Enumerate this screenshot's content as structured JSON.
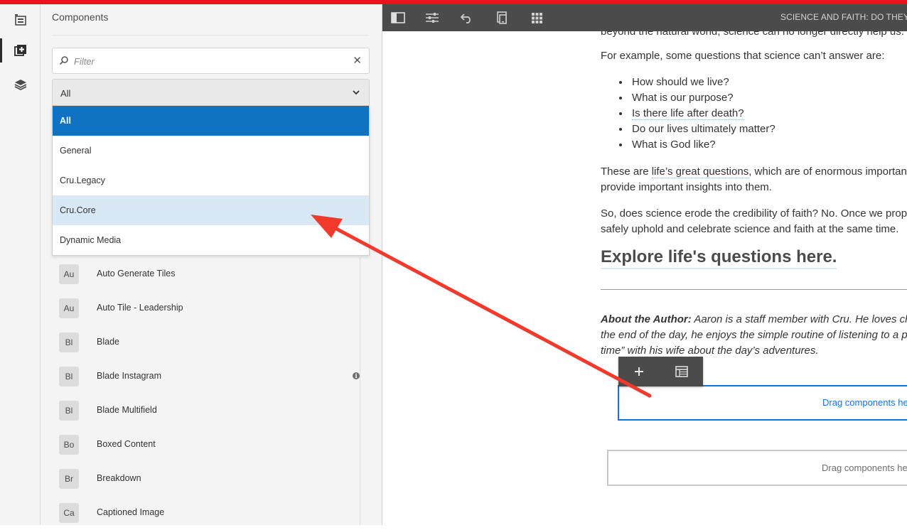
{
  "rail": {
    "items": [
      {
        "name": "page-info-icon"
      },
      {
        "name": "components-icon",
        "active": true
      },
      {
        "name": "content-tree-icon"
      }
    ]
  },
  "panel": {
    "title": "Components",
    "filter_placeholder": "Filter",
    "select_value": "All",
    "dropdown_options": [
      "All",
      "General",
      "Cru.Legacy",
      "Cru.Core",
      "Dynamic Media"
    ],
    "selected_option": "All",
    "hover_option": "Cru.Core",
    "components": [
      {
        "abbr": "Au",
        "name": "Auto Generate Tiles"
      },
      {
        "abbr": "Au",
        "name": "Auto Tile - Leadership"
      },
      {
        "abbr": "Bl",
        "name": "Blade"
      },
      {
        "abbr": "Bl",
        "name": "Blade Instagram",
        "info": true
      },
      {
        "abbr": "Bl",
        "name": "Blade Multifield"
      },
      {
        "abbr": "Bo",
        "name": "Boxed Content"
      },
      {
        "abbr": "Br",
        "name": "Breakdown"
      },
      {
        "abbr": "Ca",
        "name": "Captioned Image"
      }
    ]
  },
  "toolbar": {
    "page_title": "SCIENCE AND FAITH: DO THEY CO"
  },
  "content": {
    "cut_line": "beyond the natural world, science can no longer directly help us.",
    "intro": "For example, some questions that science can’t answer are:",
    "questions": [
      "How should we live?",
      "What is our purpose?",
      "Is there life after death?",
      "Do our lives ultimately matter?",
      "What is God like?"
    ],
    "para2_a": "These are ",
    "para2_link": "life’s great questions",
    "para2_b": ", which are of enormous importance",
    "para2_line2": "provide important insights into them.",
    "para3_line1": "So, does science erode the credibility of faith? No. Once we prope",
    "para3_line2": "safely uphold and celebrate science and faith at the same time.",
    "heading": "Explore life's questions here.",
    "author_label": "About the Author:",
    "author_line1": " Aaron is a staff member with Cru. He loves cha",
    "author_line2": "the end of the day, he enjoys the simple routine of listening to a p",
    "author_line3": "time” with his wife about the day’s adventures.",
    "drop_zone_active": "Drag components he",
    "drop_zone": "Drag components he"
  },
  "annotation": {
    "color": "#f23a2c"
  }
}
